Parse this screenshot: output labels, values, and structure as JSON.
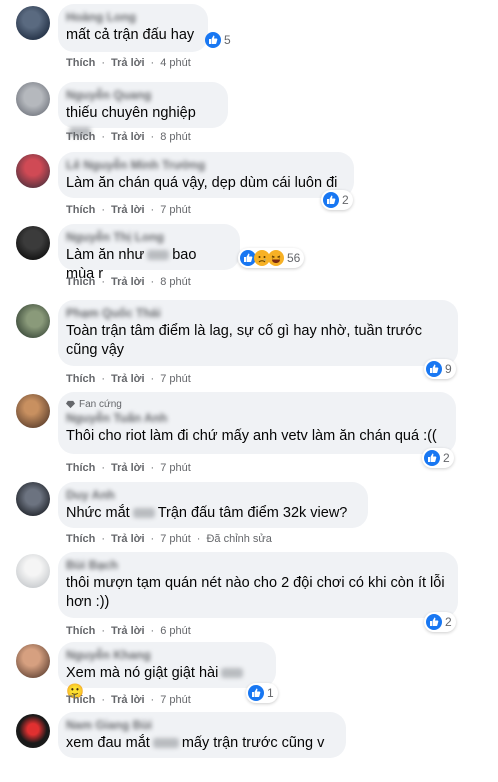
{
  "ui": {
    "like_label": "Thích",
    "reply_label": "Trả lời",
    "sep": "·"
  },
  "comments": [
    {
      "text": "mất cả trận đấu hay",
      "time": "4 phút",
      "reactions": {
        "count": "5",
        "types": [
          "like"
        ]
      }
    },
    {
      "text": "thiếu chuyên nghiệp",
      "time": "8 phút",
      "reactions": null
    },
    {
      "text": "Làm ăn chán quá vậy, dẹp dùm cái luôn đi",
      "time": "7 phút",
      "reactions": {
        "count": "2",
        "types": [
          "like"
        ]
      }
    },
    {
      "text_before": "Làm ăn như",
      "text_after": "bao mùa r",
      "time": "8 phút",
      "reactions": {
        "count": "56",
        "types": [
          "like",
          "sad",
          "haha"
        ]
      }
    },
    {
      "text": "Toàn trận tâm điểm là lag, sự cố gì hay nhờ, tuần trước cũng vậy",
      "time": "7 phút",
      "reactions": {
        "count": "9",
        "types": [
          "like"
        ]
      }
    },
    {
      "badge": "Fan cứng",
      "text": "Thôi cho riot làm đi chứ mấy anh vetv làm ăn chán quá :((",
      "time": "7 phút",
      "reactions": {
        "count": "2",
        "types": [
          "like"
        ]
      }
    },
    {
      "text_before": "Nhức mắt",
      "text_after": "Trận đấu tâm điểm 32k view?",
      "time": "7 phút",
      "edited": "Đã chỉnh sửa",
      "reactions": null
    },
    {
      "text": "thôi mượn tạm quán nét nào cho 2 đội chơi có khi còn ít lỗi hơn :))",
      "time": "6 phút",
      "reactions": {
        "count": "2",
        "types": [
          "like"
        ]
      }
    },
    {
      "text_before": "Xem mà nó giật giật hài",
      "emoji": "🙂",
      "time": "7 phút",
      "reactions": {
        "count": "1",
        "types": [
          "like"
        ]
      }
    },
    {
      "text_before": "xem đau mắt",
      "text_after": "mấy trận trước cũng v",
      "reactions": null
    }
  ],
  "colors": {
    "accent": "#1877f2",
    "bubble": "#f0f2f5",
    "meta": "#65676b"
  }
}
